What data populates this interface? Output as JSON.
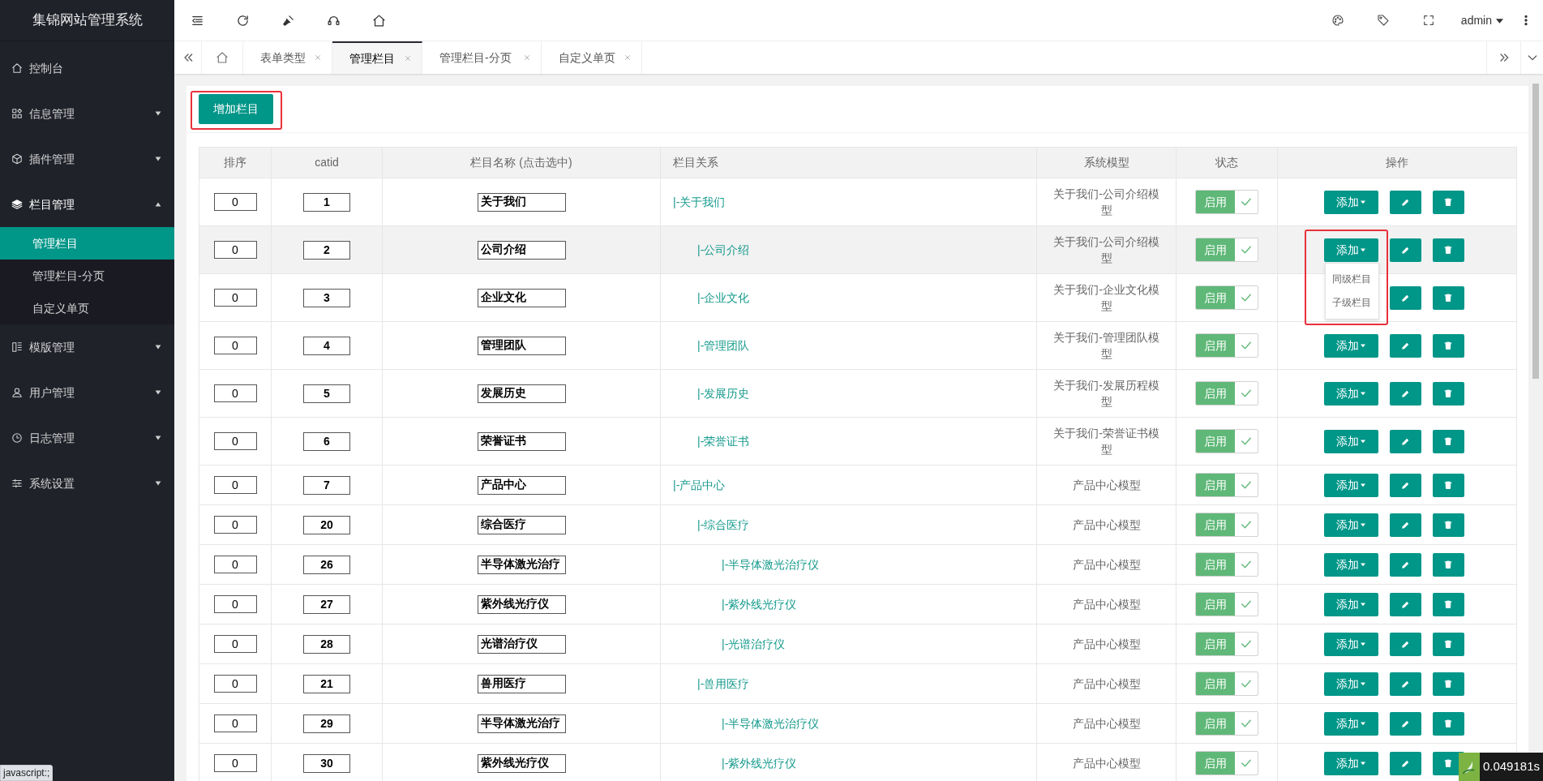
{
  "sidebar": {
    "title": "集锦网站管理系统",
    "items": [
      {
        "label": "控制台"
      },
      {
        "label": "信息管理",
        "expanded": false
      },
      {
        "label": "插件管理",
        "expanded": false
      },
      {
        "label": "栏目管理",
        "expanded": true,
        "children": [
          {
            "label": "管理栏目",
            "selected": true
          },
          {
            "label": "管理栏目-分页",
            "selected": false
          },
          {
            "label": "自定义单页",
            "selected": false
          }
        ]
      },
      {
        "label": "模版管理",
        "expanded": false
      },
      {
        "label": "用户管理",
        "expanded": false
      },
      {
        "label": "日志管理",
        "expanded": false
      },
      {
        "label": "系统设置",
        "expanded": false
      }
    ]
  },
  "header": {
    "user": "admin"
  },
  "tabs": [
    {
      "label": "表单类型",
      "selected": false
    },
    {
      "label": "管理栏目",
      "selected": true
    },
    {
      "label": "管理栏目-分页",
      "selected": false
    },
    {
      "label": "自定义单页",
      "selected": false
    }
  ],
  "add_category_button": {
    "label": "增加栏目",
    "highlighted": true
  },
  "table": {
    "columns": [
      "排序",
      "catid",
      "栏目名称 (点击选中)",
      "栏目关系",
      "系统模型",
      "状态",
      "操作"
    ],
    "rows": [
      {
        "sort": "0",
        "catid": "1",
        "name": "关于我们",
        "relation": "|-关于我们",
        "model": "关于我们-公司介绍模型",
        "status": {
          "label": "启用",
          "on": true
        },
        "add": "添加",
        "hovered": false,
        "children": [
          {
            "sort": "0",
            "catid": "2",
            "name": "公司介绍",
            "relation": "|-公司介绍",
            "model": "关于我们-公司介绍模型",
            "status": {
              "label": "启用",
              "on": true
            },
            "add": "添加",
            "hovered": true,
            "add_menu": {
              "items": [
                "同级栏目",
                "子级栏目"
              ],
              "highlighted": true
            }
          },
          {
            "sort": "0",
            "catid": "3",
            "name": "企业文化",
            "relation": "|-企业文化",
            "model": "关于我们-企业文化模型",
            "status": {
              "label": "启用",
              "on": true
            },
            "hovered": false
          },
          {
            "sort": "0",
            "catid": "4",
            "name": "管理团队",
            "relation": "|-管理团队",
            "model": "关于我们-管理团队模型",
            "status": {
              "label": "启用",
              "on": true
            },
            "add": "添加",
            "hovered": false
          },
          {
            "sort": "0",
            "catid": "5",
            "name": "发展历史",
            "relation": "|-发展历史",
            "model": "关于我们-发展历程模型",
            "status": {
              "label": "启用",
              "on": true
            },
            "add": "添加",
            "hovered": false
          },
          {
            "sort": "0",
            "catid": "6",
            "name": "荣誉证书",
            "relation": "|-荣誉证书",
            "model": "关于我们-荣誉证书模型",
            "status": {
              "label": "启用",
              "on": true
            },
            "add": "添加",
            "hovered": false
          }
        ]
      },
      {
        "sort": "0",
        "catid": "7",
        "name": "产品中心",
        "relation": "|-产品中心",
        "model": "产品中心模型",
        "status": {
          "label": "启用",
          "on": true
        },
        "add": "添加",
        "hovered": false,
        "children": [
          {
            "sort": "0",
            "catid": "20",
            "name": "综合医疗",
            "relation": "|-综合医疗",
            "model": "产品中心模型",
            "status": {
              "label": "启用",
              "on": true
            },
            "add": "添加",
            "hovered": false,
            "children": [
              {
                "sort": "0",
                "catid": "26",
                "name": "半导体激光治疗",
                "relation": "|-半导体激光治疗仪",
                "model": "产品中心模型",
                "status": {
                  "label": "启用",
                  "on": true
                },
                "add": "添加",
                "hovered": false
              },
              {
                "sort": "0",
                "catid": "27",
                "name": "紫外线光疗仪",
                "relation": "|-紫外线光疗仪",
                "model": "产品中心模型",
                "status": {
                  "label": "启用",
                  "on": true
                },
                "add": "添加",
                "hovered": false
              },
              {
                "sort": "0",
                "catid": "28",
                "name": "光谱治疗仪",
                "relation": "|-光谱治疗仪",
                "model": "产品中心模型",
                "status": {
                  "label": "启用",
                  "on": true
                },
                "add": "添加",
                "hovered": false
              }
            ]
          },
          {
            "sort": "0",
            "catid": "21",
            "name": "兽用医疗",
            "relation": "|-兽用医疗",
            "model": "产品中心模型",
            "status": {
              "label": "启用",
              "on": true
            },
            "add": "添加",
            "hovered": false,
            "children": [
              {
                "sort": "0",
                "catid": "29",
                "name": "半导体激光治疗",
                "relation": "|-半导体激光治疗仪",
                "model": "产品中心模型",
                "status": {
                  "label": "启用",
                  "on": true
                },
                "add": "添加",
                "hovered": false
              },
              {
                "sort": "0",
                "catid": "30",
                "name": "紫外线光疗仪",
                "relation": "|-紫外线光疗仪",
                "model": "产品中心模型",
                "status": {
                  "label": "启用",
                  "on": true
                },
                "add": "添加",
                "hovered": false
              }
            ]
          }
        ]
      }
    ]
  },
  "status_url": "javascript:;",
  "debug_timer": "0.049181s"
}
